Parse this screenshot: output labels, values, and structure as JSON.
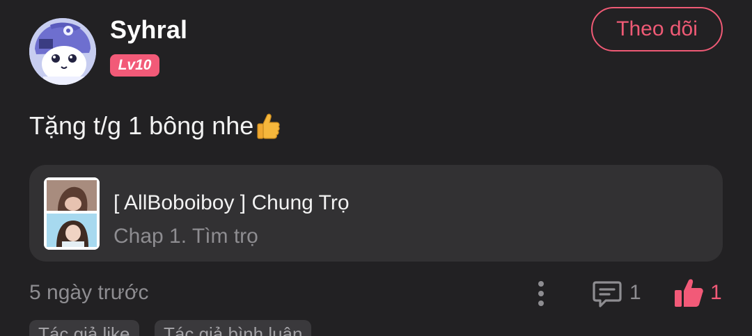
{
  "user": {
    "name": "Syhral",
    "level": "Lv10"
  },
  "follow_button": {
    "label": "Theo dõi"
  },
  "comment": {
    "text": "Tặng t/g 1 bông nhe",
    "emoji": "thumbs-up-emoji"
  },
  "story": {
    "title": "[ AllBoboiboy ] Chung Trọ",
    "chapter": "Chap 1. Tìm trọ"
  },
  "footer": {
    "timestamp": "5 ngày trước",
    "comment_count": "1",
    "like_count": "1"
  },
  "tags": [
    {
      "label": "Tác giả like"
    },
    {
      "label": "Tác giả bình luận"
    }
  ],
  "colors": {
    "background": "#222123",
    "card": "#323133",
    "accent": "#f25a78",
    "muted_text": "#8e8d91"
  },
  "icons": {
    "more": "more-vertical-icon",
    "comment": "comment-icon",
    "like": "thumbs-up-icon"
  }
}
